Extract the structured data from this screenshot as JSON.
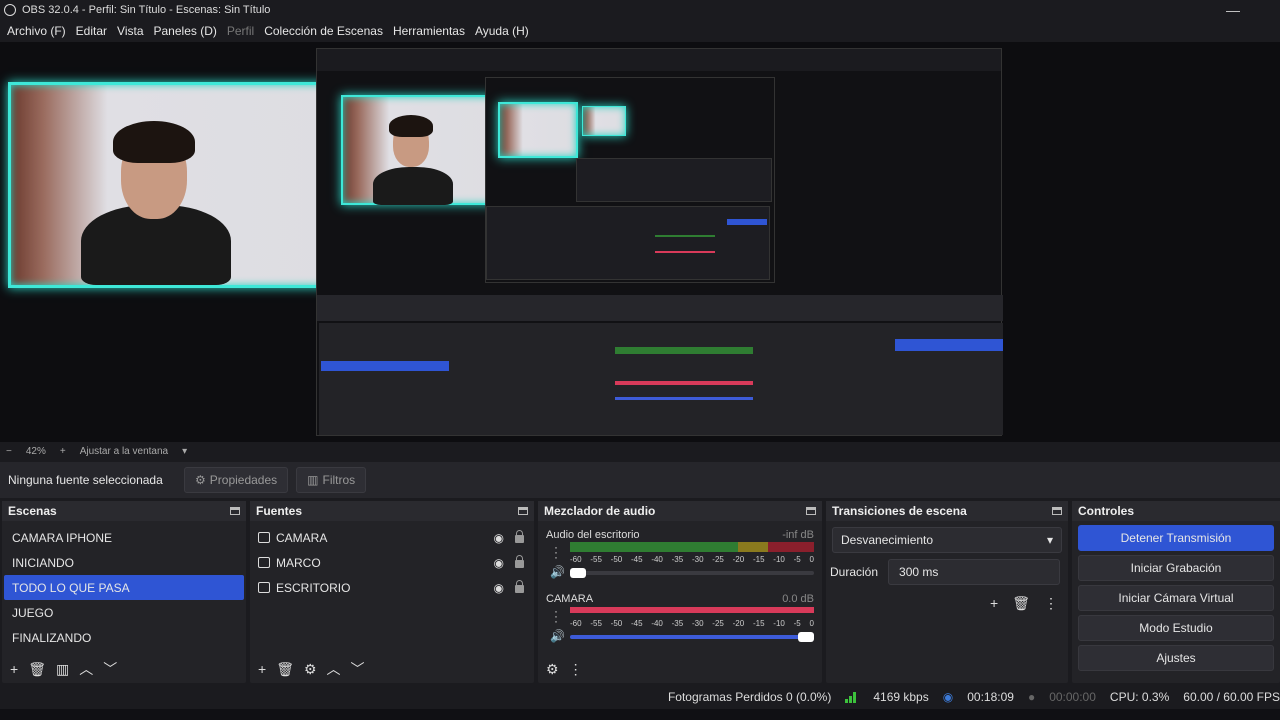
{
  "window": {
    "title": "OBS 32.0.4 - Perfil: Sin Título - Escenas: Sin Título"
  },
  "menu": [
    {
      "label": "Archivo (F)",
      "disabled": false
    },
    {
      "label": "Editar",
      "disabled": false
    },
    {
      "label": "Vista",
      "disabled": false
    },
    {
      "label": "Paneles (D)",
      "disabled": false
    },
    {
      "label": "Perfil",
      "disabled": true
    },
    {
      "label": "Colección de Escenas",
      "disabled": false
    },
    {
      "label": "Herramientas",
      "disabled": false
    },
    {
      "label": "Ayuda (H)",
      "disabled": false
    }
  ],
  "zoom": {
    "minus": "−",
    "value": "42%",
    "plus": "+",
    "fit": "Ajustar a la ventana"
  },
  "source_bar": {
    "no_source": "Ninguna fuente seleccionada",
    "properties": "Propiedades",
    "filters": "Filtros"
  },
  "scenes": {
    "title": "Escenas",
    "items": [
      "CAMARA IPHONE",
      "INICIANDO",
      "TODO LO QUE PASA",
      "JUEGO",
      "FINALIZANDO"
    ],
    "selected_index": 2
  },
  "sources": {
    "title": "Fuentes",
    "items": [
      {
        "name": "CAMARA",
        "icon": "camera-icon"
      },
      {
        "name": "MARCO",
        "icon": "image-icon"
      },
      {
        "name": "ESCRITORIO",
        "icon": "display-icon"
      }
    ]
  },
  "mixer": {
    "title": "Mezclador de audio",
    "ticks": [
      "-60",
      "-55",
      "-50",
      "-45",
      "-40",
      "-35",
      "-30",
      "-25",
      "-20",
      "-15",
      "-10",
      "-5",
      "0"
    ],
    "channels": [
      {
        "name": "Audio del escritorio",
        "db": "-inf dB",
        "volume": 0.04
      },
      {
        "name": "CAMARA",
        "db": "0.0 dB",
        "volume": 1.0
      }
    ]
  },
  "transitions": {
    "title": "Transiciones de escena",
    "selected": "Desvanecimiento",
    "duration_label": "Duración",
    "duration_value": "300 ms"
  },
  "controls": {
    "title": "Controles",
    "buttons": [
      "Detener Transmisión",
      "Iniciar Grabación",
      "Iniciar Cámara Virtual",
      "Modo Estudio",
      "Ajustes"
    ]
  },
  "status": {
    "dropped": "Fotogramas Perdidos 0 (0.0%)",
    "bitrate": "4169 kbps",
    "stream_time": "00:18:09",
    "rec_time": "00:00:00",
    "cpu": "CPU: 0.3%",
    "fps": "60.00 / 60.00 FPS"
  },
  "colors": {
    "accent": "#2f55d4",
    "frame": "#3ee8d8",
    "meter_green": "#2f7d32",
    "meter_yellow": "#8a7a1e",
    "meter_red": "#8a1f2c",
    "meter_active_red": "#d83a5a"
  }
}
